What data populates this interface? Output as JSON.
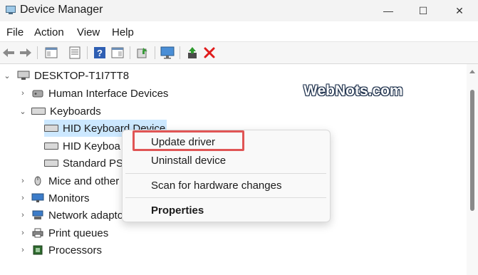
{
  "window": {
    "title": "Device Manager",
    "minimize": "—",
    "maximize": "☐",
    "close": "✕"
  },
  "menu": [
    "File",
    "Action",
    "View",
    "Help"
  ],
  "toolbar_icons": [
    "back-icon",
    "forward-icon",
    "show-hide-console-icon",
    "properties-icon",
    "help-icon",
    "action-pane-icon",
    "update-driver-icon",
    "monitor-icon",
    "enable-device-icon",
    "uninstall-icon"
  ],
  "tree": {
    "root": "DESKTOP-T1I7TT8",
    "items": [
      {
        "label": "Human Interface Devices",
        "expanded": false
      },
      {
        "label": "Keyboards",
        "expanded": true,
        "children": [
          "HID Keyboard Device",
          "HID Keyboa",
          "Standard PS"
        ]
      },
      {
        "label": "Mice and other",
        "expanded": false
      },
      {
        "label": "Monitors",
        "expanded": false
      },
      {
        "label": "Network adapto",
        "expanded": false
      },
      {
        "label": "Print queues",
        "expanded": false
      },
      {
        "label": "Processors",
        "expanded": false
      }
    ]
  },
  "context_menu": {
    "items": [
      "Update driver",
      "Uninstall device",
      "Scan for hardware changes",
      "Properties"
    ]
  },
  "watermark": "WebNots.com",
  "colors": {
    "highlight_border": "#e05555",
    "selection": "#cce8ff",
    "delete_red": "#e01b1b"
  }
}
